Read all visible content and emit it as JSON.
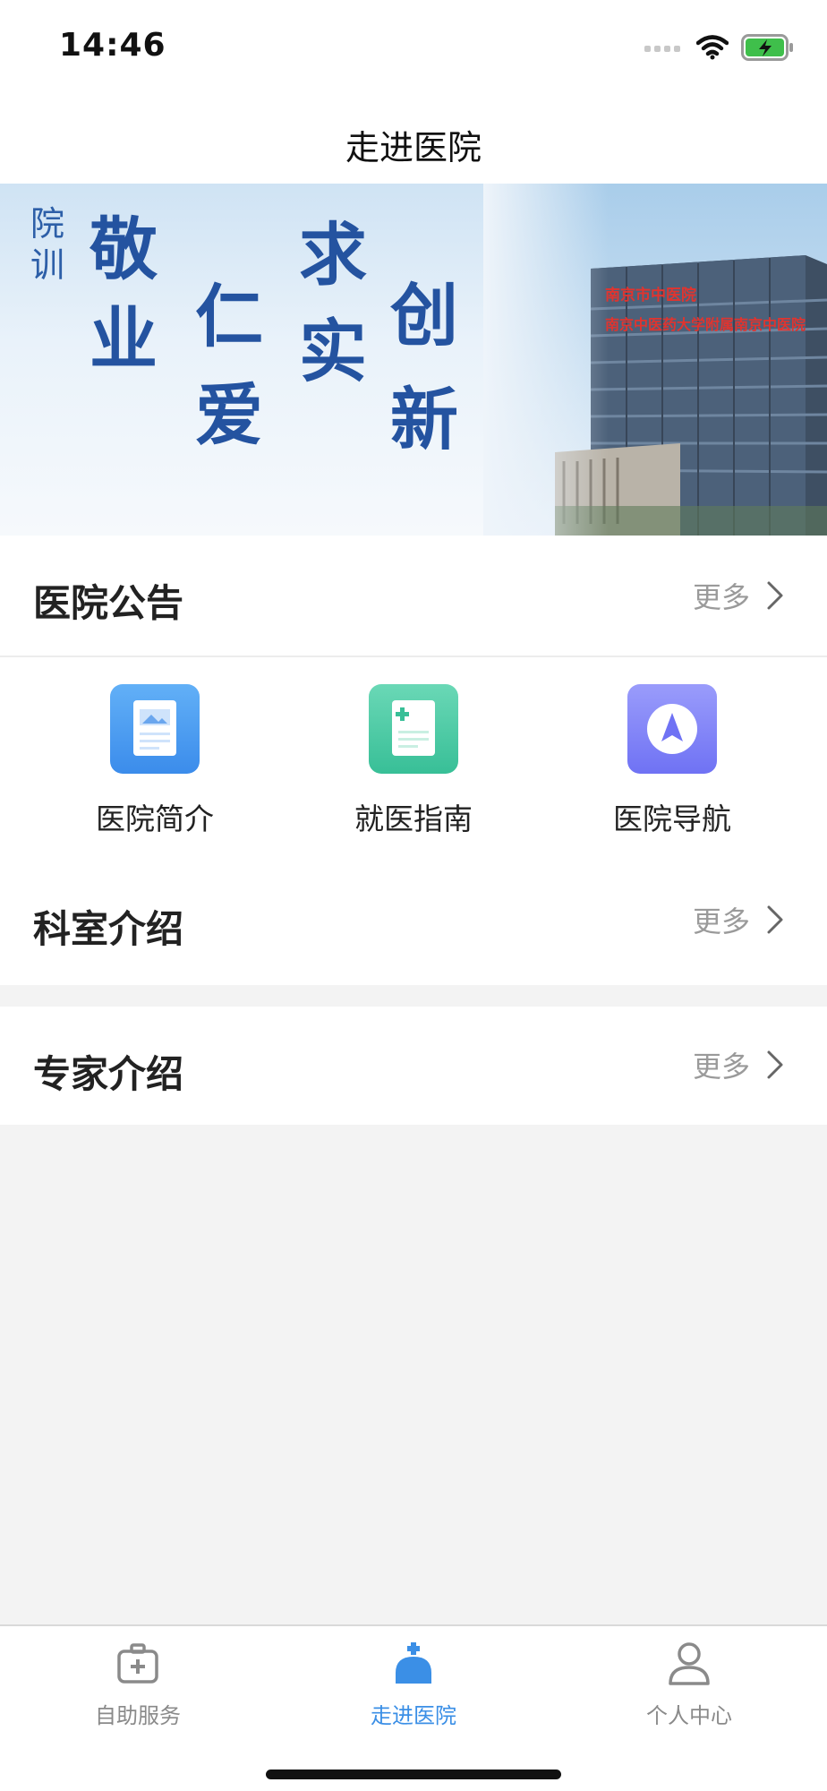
{
  "status_bar": {
    "time": "14:46"
  },
  "nav": {
    "title": "走进医院"
  },
  "banner": {
    "motto_label": "院训",
    "motto_words": [
      "敬业",
      "仁爱",
      "求实",
      "创新"
    ],
    "building_signs": [
      "南京市中医院",
      "南京中医药大学附属南京中医院"
    ]
  },
  "notice": {
    "title": "医院公告",
    "more": "更多"
  },
  "quick_links": [
    {
      "label": "医院简介",
      "icon": "document-image-icon",
      "color": "#3d93f0"
    },
    {
      "label": "就医指南",
      "icon": "medical-guide-icon",
      "color": "#42c6a0"
    },
    {
      "label": "医院导航",
      "icon": "compass-icon",
      "color": "#7b7df8"
    }
  ],
  "departments": {
    "title": "科室介绍",
    "more": "更多"
  },
  "experts": {
    "title": "专家介绍",
    "more": "更多"
  },
  "tabbar": {
    "items": [
      {
        "label": "自助服务",
        "icon": "medical-kit-icon",
        "active": false
      },
      {
        "label": "走进医院",
        "icon": "hospital-icon",
        "active": true
      },
      {
        "label": "个人中心",
        "icon": "user-icon",
        "active": false
      }
    ],
    "active_color": "#3b8fe6"
  }
}
